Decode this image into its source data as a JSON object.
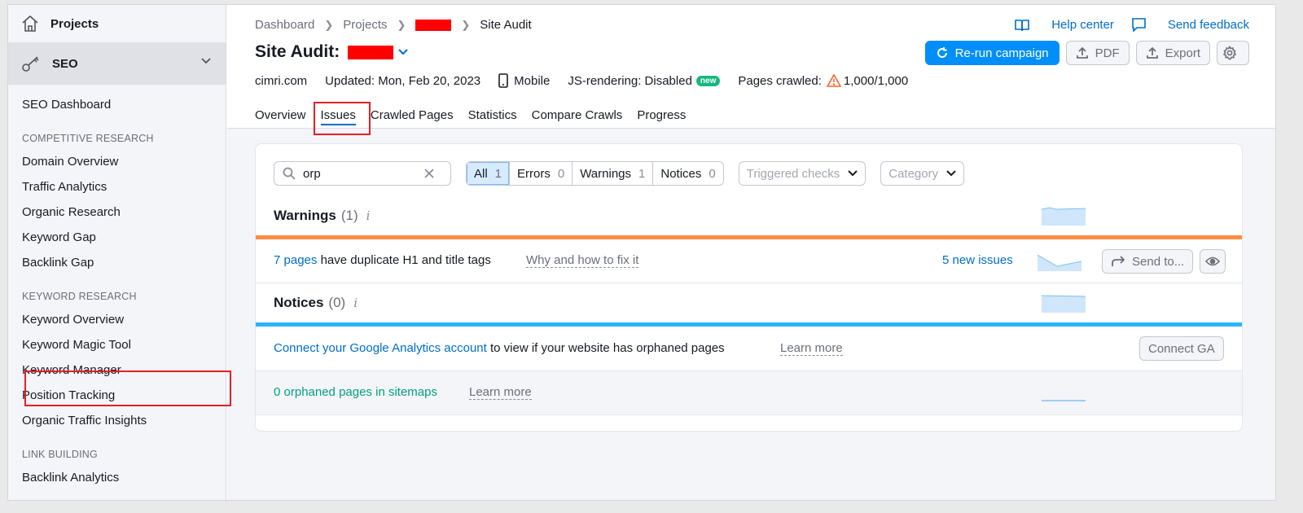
{
  "sidebar": {
    "projects_label": "Projects",
    "seo_label": "SEO",
    "dashboard": "SEO Dashboard",
    "sections": [
      {
        "title": "COMPETITIVE RESEARCH",
        "items": [
          "Domain Overview",
          "Traffic Analytics",
          "Organic Research",
          "Keyword Gap",
          "Backlink Gap"
        ]
      },
      {
        "title": "KEYWORD RESEARCH",
        "items": [
          "Keyword Overview",
          "Keyword Magic Tool",
          "Keyword Manager",
          "Position Tracking",
          "Organic Traffic Insights"
        ]
      },
      {
        "title": "LINK BUILDING",
        "items": [
          "Backlink Analytics"
        ]
      }
    ]
  },
  "header": {
    "breadcrumbs": [
      "Dashboard",
      "Projects",
      "Site Audit"
    ],
    "title": "Site Audit:",
    "domain": "cimri.com",
    "updated": "Updated: Mon, Feb 20, 2023",
    "device": "Mobile",
    "js_rendering": "JS-rendering: Disabled",
    "new_badge": "new",
    "pages_crawled_label": "Pages crawled:",
    "pages_crawled_value": "1,000/1,000",
    "help_center": "Help center",
    "send_feedback": "Send feedback",
    "rerun": "Re-run campaign",
    "pdf": "PDF",
    "export": "Export",
    "tabs": [
      "Overview",
      "Issues",
      "Crawled Pages",
      "Statistics",
      "Compare Crawls",
      "Progress"
    ],
    "active_tab": "Issues"
  },
  "filters": {
    "search_value": "orp",
    "segments": [
      {
        "label": "All",
        "count": "1"
      },
      {
        "label": "Errors",
        "count": "0"
      },
      {
        "label": "Warnings",
        "count": "1"
      },
      {
        "label": "Notices",
        "count": "0"
      }
    ],
    "triggered_checks": "Triggered checks",
    "category": "Category"
  },
  "warnings": {
    "title": "Warnings",
    "count": "(1)",
    "info": "i",
    "issue_link": "7 pages",
    "issue_text": "have duplicate H1 and title tags",
    "fix_link": "Why and how to fix it",
    "new_issues": "5 new issues",
    "send_to": "Send to..."
  },
  "notices": {
    "title": "Notices",
    "count": "(0)",
    "info": "i",
    "ga_link": "Connect your Google Analytics account",
    "ga_text": "to view if your website has orphaned pages",
    "learn_more": "Learn more",
    "connect_ga": "Connect GA",
    "orphaned": "0 orphaned pages in sitemaps",
    "orphaned_learn_more": "Learn more"
  },
  "colors": {
    "accent": "#008ff8",
    "link": "#006dca",
    "warning_bar": "#ff8c43",
    "notice_bar": "#2bb3ff",
    "new_badge": "#14b87d",
    "highlight": "#e41e26",
    "redaction": "#ff0000"
  }
}
